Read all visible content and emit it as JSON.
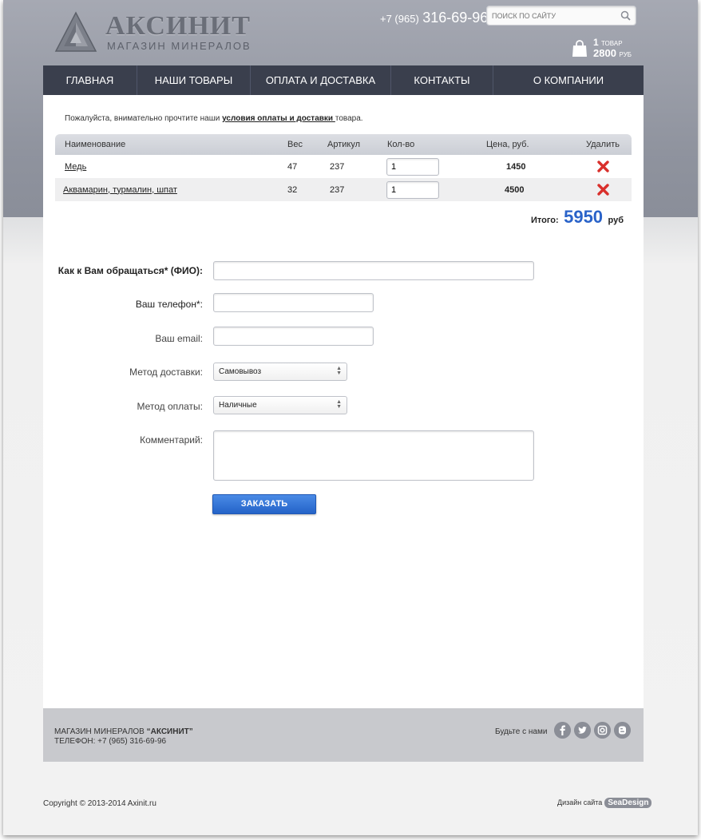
{
  "brand": {
    "title": "АКСИНИТ",
    "subtitle": "МАГАЗИН МИНЕРАЛОВ"
  },
  "header": {
    "phone_code": "+7 (965)",
    "phone_number": "316-69-96",
    "search_placeholder": "ПОИСК ПО САЙТУ",
    "cart_count": "1",
    "cart_count_unit": "ТОВАР",
    "cart_sum": "2800",
    "cart_sum_unit": "РУБ"
  },
  "nav": [
    {
      "label": "Главная"
    },
    {
      "label": "Наши товары"
    },
    {
      "label": "Оплата и доставка"
    },
    {
      "label": "Контакты"
    },
    {
      "label": "О компании"
    }
  ],
  "notice": {
    "before": "Пожалуйста, внимательно прочтите наши ",
    "link": "условия оплаты и доставки ",
    "after": "товара."
  },
  "cart_table": {
    "headers": {
      "name": "Наименование",
      "weight": "Вес",
      "article": "Артикул",
      "qty": "Кол-во",
      "price": "Цена, руб.",
      "delete": "Удалить"
    },
    "rows": [
      {
        "name": "Медь",
        "weight": "47",
        "article": "237",
        "qty": "1",
        "price": "1450"
      },
      {
        "name": "Аквамарин, турмалин, шпат",
        "weight": "32",
        "article": "237",
        "qty": "1",
        "price": "4500"
      }
    ],
    "total_label": "Итого:",
    "total_value": "5950",
    "total_currency": "руб"
  },
  "form": {
    "name_label": "Как к Вам обращаться* (ФИО):",
    "phone_label": "Ваш телефон*:",
    "email_label": "Ваш email:",
    "delivery_label": "Метод доставки:",
    "delivery_value": "Самовывоз",
    "payment_label": "Метод оплаты:",
    "payment_value": "Наличные",
    "comment_label": "Комментарий:",
    "submit_label": "ЗАКАЗАТЬ"
  },
  "footer": {
    "name_prefix": "МАГАЗИН МИНЕРАЛОВ ",
    "name_brand": "“АКСИНИТ”",
    "phone": "ТЕЛЕФОН: +7 (965) 316-69-96",
    "follow": "Будьте с нами",
    "copyright": "Copyright © 2013-2014 Axinit.ru",
    "design_label": "Дизайн сайта",
    "design_badge": "SeaDesign"
  },
  "colors": {
    "nav_bg": "#3a3f4d",
    "accent": "#2a63c9",
    "delete": "#d9302c"
  }
}
